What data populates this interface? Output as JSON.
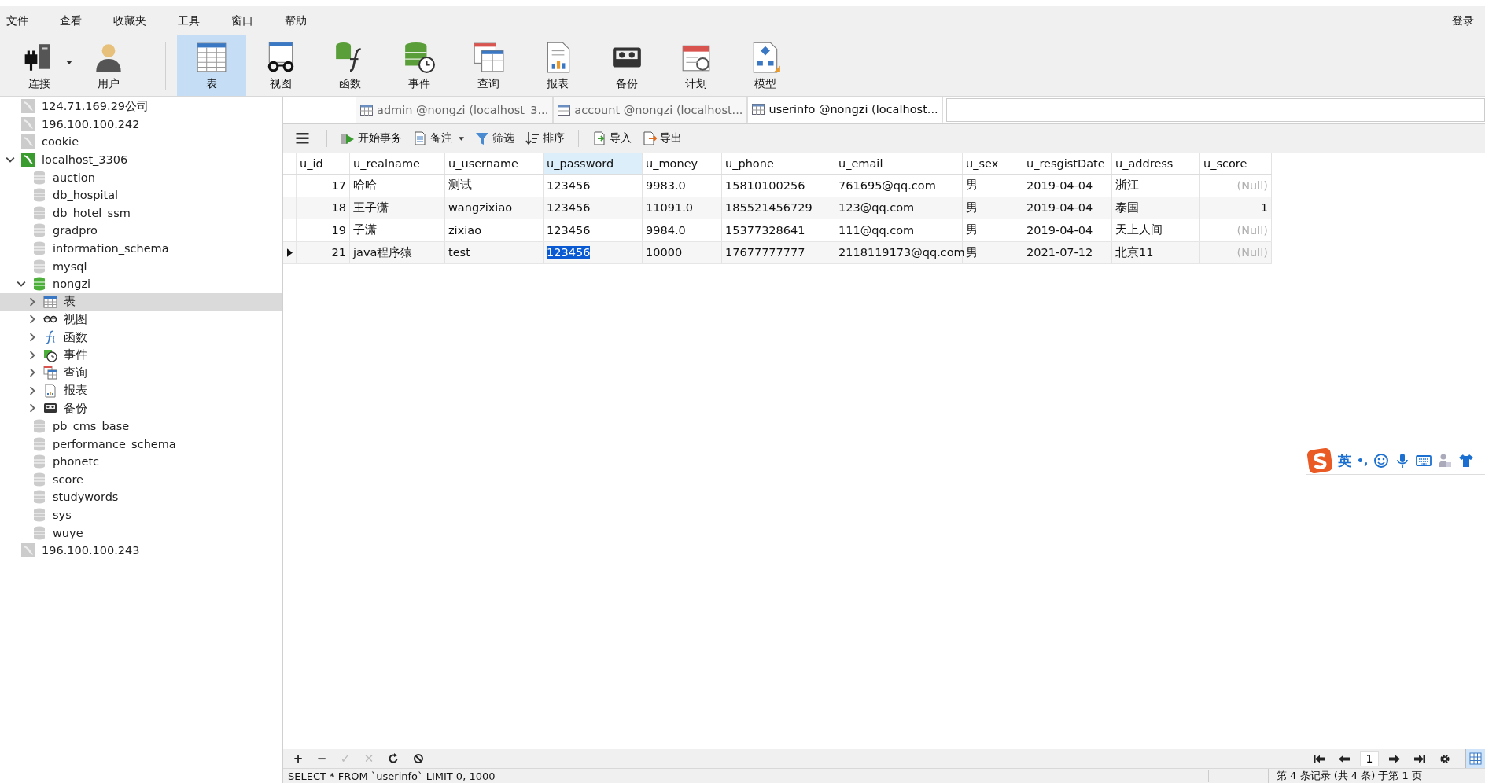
{
  "menu": [
    "文件",
    "查看",
    "收藏夹",
    "工具",
    "窗口",
    "帮助"
  ],
  "login": "登录",
  "toolbar": [
    {
      "kind": "connect",
      "label": "连接",
      "selected": false,
      "dropdown": true
    },
    {
      "kind": "user",
      "label": "用户",
      "selected": false
    },
    {
      "kind": "table",
      "label": "表",
      "selected": true
    },
    {
      "kind": "view",
      "label": "视图",
      "selected": false
    },
    {
      "kind": "function",
      "label": "函数",
      "selected": false
    },
    {
      "kind": "event",
      "label": "事件",
      "selected": false
    },
    {
      "kind": "query",
      "label": "查询",
      "selected": false
    },
    {
      "kind": "report",
      "label": "报表",
      "selected": false
    },
    {
      "kind": "backup",
      "label": "备份",
      "selected": false
    },
    {
      "kind": "schedule",
      "label": "计划",
      "selected": false
    },
    {
      "kind": "model",
      "label": "模型",
      "selected": false
    }
  ],
  "sidebar": {
    "items": [
      {
        "kind": "connection",
        "label": "124.71.169.29公司",
        "connected": false,
        "selected": false
      },
      {
        "kind": "connection",
        "label": "196.100.100.242",
        "connected": false,
        "selected": false
      },
      {
        "kind": "connection",
        "label": "cookie",
        "connected": false,
        "selected": false
      },
      {
        "kind": "connection",
        "label": "localhost_3306",
        "connected": true,
        "expanded": true,
        "selected": false,
        "children": [
          {
            "kind": "database",
            "label": "auction",
            "open": false,
            "selected": false
          },
          {
            "kind": "database",
            "label": "db_hospital",
            "open": false,
            "selected": false
          },
          {
            "kind": "database",
            "label": "db_hotel_ssm",
            "open": false,
            "selected": false
          },
          {
            "kind": "database",
            "label": "gradpro",
            "open": false,
            "selected": false
          },
          {
            "kind": "database",
            "label": "information_schema",
            "open": false,
            "selected": false
          },
          {
            "kind": "database",
            "label": "mysql",
            "open": false,
            "selected": false
          },
          {
            "kind": "database",
            "label": "nongzi",
            "open": true,
            "expanded": true,
            "selected": false,
            "children": [
              {
                "kind": "table",
                "label": "表",
                "expanded": false,
                "selected": true
              },
              {
                "kind": "view",
                "label": "视图",
                "expanded": false,
                "selected": false
              },
              {
                "kind": "function",
                "label": "函数",
                "expanded": false,
                "selected": false
              },
              {
                "kind": "event",
                "label": "事件",
                "expanded": false,
                "selected": false
              },
              {
                "kind": "query",
                "label": "查询",
                "expanded": false,
                "selected": false
              },
              {
                "kind": "report",
                "label": "报表",
                "expanded": false,
                "selected": false
              },
              {
                "kind": "backup",
                "label": "备份",
                "expanded": false,
                "selected": false
              }
            ]
          },
          {
            "kind": "database",
            "label": "pb_cms_base",
            "open": false,
            "selected": false
          },
          {
            "kind": "database",
            "label": "performance_schema",
            "open": false,
            "selected": false
          },
          {
            "kind": "database",
            "label": "phonetc",
            "open": false,
            "selected": false
          },
          {
            "kind": "database",
            "label": "score",
            "open": false,
            "selected": false
          },
          {
            "kind": "database",
            "label": "studywords",
            "open": false,
            "selected": false
          },
          {
            "kind": "database",
            "label": "sys",
            "open": false,
            "selected": false
          },
          {
            "kind": "database",
            "label": "wuye",
            "open": false,
            "selected": false
          }
        ]
      },
      {
        "kind": "connection",
        "label": "196.100.100.243",
        "connected": false,
        "selected": false
      }
    ]
  },
  "tabs": [
    {
      "label": "admin @nongzi (localhost_3...",
      "selected": false
    },
    {
      "label": "account @nongzi (localhost...",
      "selected": false
    },
    {
      "label": "userinfo @nongzi (localhost...",
      "selected": true
    }
  ],
  "actions": [
    {
      "kind": "begin",
      "label": "开始事务"
    },
    {
      "kind": "note",
      "label": "备注",
      "dropdown": true
    },
    {
      "kind": "filter",
      "label": "筛选"
    },
    {
      "kind": "sort",
      "label": "排序"
    },
    {
      "kind": "import",
      "label": "导入"
    },
    {
      "kind": "export",
      "label": "导出"
    }
  ],
  "table": {
    "columns": [
      {
        "label": "u_id",
        "kind": "number",
        "selected": false
      },
      {
        "label": "u_realname",
        "kind": "text",
        "selected": false
      },
      {
        "label": "u_username",
        "kind": "text",
        "selected": false
      },
      {
        "label": "u_password",
        "kind": "text",
        "selected": true
      },
      {
        "label": "u_money",
        "kind": "text",
        "selected": false
      },
      {
        "label": "u_phone",
        "kind": "text",
        "selected": false
      },
      {
        "label": "u_email",
        "kind": "text",
        "selected": false
      },
      {
        "label": "u_sex",
        "kind": "text",
        "selected": false
      },
      {
        "label": "u_resgistDate",
        "kind": "text",
        "selected": false
      },
      {
        "label": "u_address",
        "kind": "text",
        "selected": false
      },
      {
        "label": "u_score",
        "kind": "number",
        "selected": false
      }
    ],
    "rows": [
      {
        "selected": false,
        "cells": [
          {
            "text": "17",
            "selected": false
          },
          {
            "text": "哈哈",
            "selected": false
          },
          {
            "text": "测试",
            "selected": false
          },
          {
            "text": "123456",
            "selected": false
          },
          {
            "text": "9983.0",
            "selected": false
          },
          {
            "text": "15810100256",
            "selected": false
          },
          {
            "text": "761695@qq.com",
            "selected": false
          },
          {
            "text": "男",
            "selected": false
          },
          {
            "text": "2019-04-04",
            "selected": false
          },
          {
            "text": "浙江",
            "selected": false
          },
          {
            "text": "(Null)",
            "selected": false,
            "null": true
          }
        ]
      },
      {
        "selected": false,
        "cells": [
          {
            "text": "18",
            "selected": false
          },
          {
            "text": "王子潇",
            "selected": false
          },
          {
            "text": "wangzixiao",
            "selected": false
          },
          {
            "text": "123456",
            "selected": false
          },
          {
            "text": "11091.0",
            "selected": false
          },
          {
            "text": "185521456729",
            "selected": false
          },
          {
            "text": "123@qq.com",
            "selected": false
          },
          {
            "text": "男",
            "selected": false
          },
          {
            "text": "2019-04-04",
            "selected": false
          },
          {
            "text": "泰国",
            "selected": false
          },
          {
            "text": "1",
            "selected": false
          }
        ]
      },
      {
        "selected": false,
        "cells": [
          {
            "text": "19",
            "selected": false
          },
          {
            "text": "子潇",
            "selected": false
          },
          {
            "text": "zixiao",
            "selected": false
          },
          {
            "text": "123456",
            "selected": false
          },
          {
            "text": "9984.0",
            "selected": false
          },
          {
            "text": "15377328641",
            "selected": false
          },
          {
            "text": "111@qq.com",
            "selected": false
          },
          {
            "text": "男",
            "selected": false
          },
          {
            "text": "2019-04-04",
            "selected": false
          },
          {
            "text": "天上人间",
            "selected": false
          },
          {
            "text": "(Null)",
            "selected": false,
            "null": true
          }
        ]
      },
      {
        "selected": true,
        "cells": [
          {
            "text": "21",
            "selected": false
          },
          {
            "text": "java程序猿",
            "selected": false
          },
          {
            "text": " test",
            "selected": false
          },
          {
            "text": "123456",
            "selected": true
          },
          {
            "text": "10000",
            "selected": false
          },
          {
            "text": "17677777777",
            "selected": false
          },
          {
            "text": "2118119173@qq.com",
            "selected": false
          },
          {
            "text": "男",
            "selected": false
          },
          {
            "text": "2021-07-12",
            "selected": false
          },
          {
            "text": "北京11",
            "selected": false
          },
          {
            "text": "(Null)",
            "selected": false,
            "null": true
          }
        ]
      }
    ]
  },
  "record_tools": [
    {
      "kind": "text",
      "label": "+",
      "disabled": false
    },
    {
      "kind": "text",
      "label": "−",
      "disabled": false
    },
    {
      "kind": "text",
      "label": "✓",
      "disabled": true
    },
    {
      "kind": "text",
      "label": "✕",
      "disabled": true
    },
    {
      "kind": "refresh",
      "disabled": false
    },
    {
      "kind": "stop",
      "disabled": false
    }
  ],
  "page": {
    "value": "1"
  },
  "ime": {
    "language": "英",
    "punctuation": "•,"
  },
  "status_bar": {
    "query": "SELECT * FROM `userinfo` LIMIT 0, 1000",
    "records": "第 4 条记录 (共 4 条) 于第 1 页"
  }
}
